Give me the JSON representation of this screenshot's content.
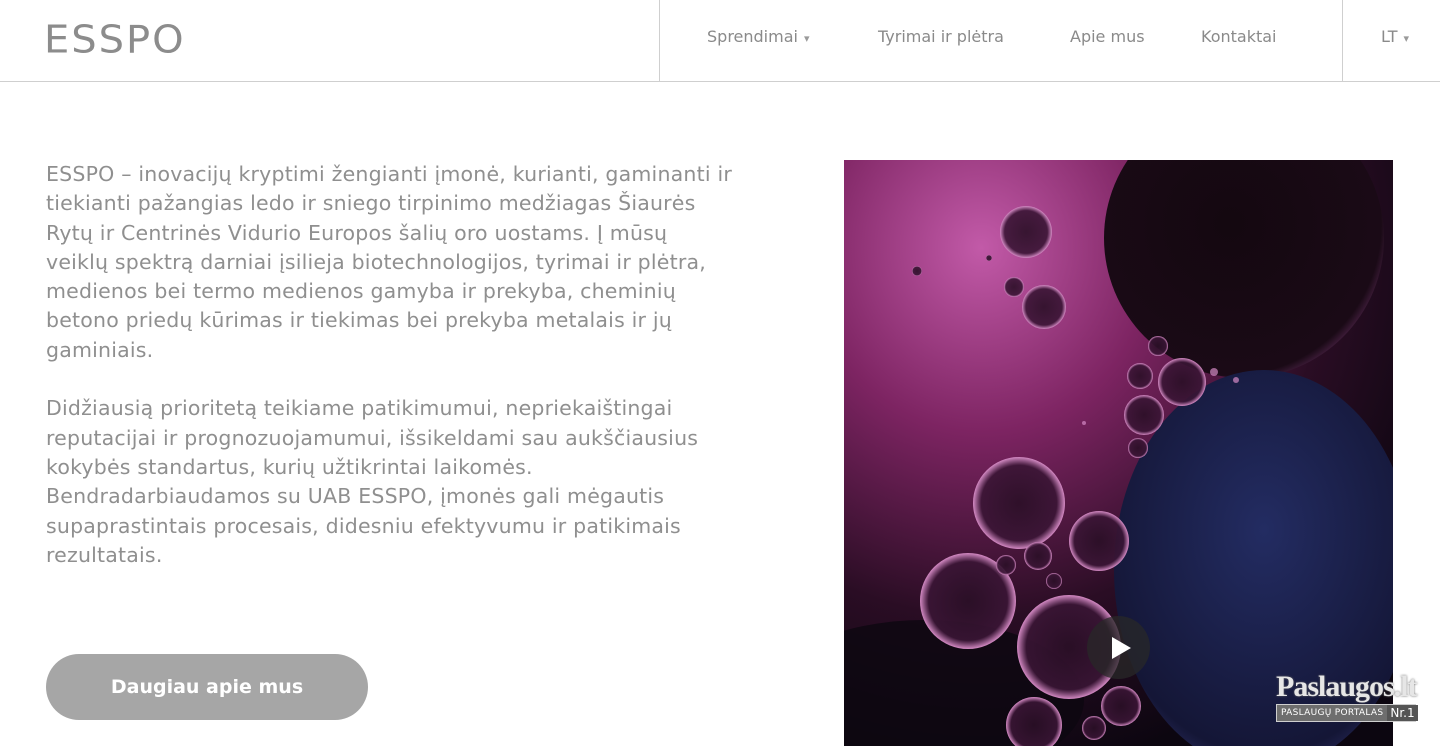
{
  "header": {
    "logo": "ESSPO",
    "nav": [
      {
        "label": "Sprendimai",
        "dropdown": true
      },
      {
        "label": "Tyrimai ir plėtra",
        "dropdown": false
      },
      {
        "label": "Apie mus",
        "dropdown": false
      },
      {
        "label": "Kontaktai",
        "dropdown": false
      }
    ],
    "language": "LT"
  },
  "main": {
    "paragraphs": [
      "ESSPO – inovacijų kryptimi žengianti įmonė, kurianti, gaminanti ir tiekianti pažangias ledo ir sniego tirpinimo medžiagas Šiaurės Rytų ir Centrinės Vidurio Europos šalių oro uostams. Į mūsų veiklų spektrą darniai įsilieja biotechnologijos, tyrimai ir plėtra, medienos bei termo medienos gamyba ir prekyba, cheminių betono priedų kūrimas ir tiekimas bei prekyba metalais ir jų gaminiais.",
      "Didžiausią prioritetą teikiame patikimumui, nepriekaištingai reputacijai ir prognozuojamumui, išsikeldami sau aukščiausius kokybės standartus, kurių užtikrintai laikomės. Bendradarbiaudamos su UAB ESSPO, įmonės gali mėgautis supaprastintais procesais, didesniu efektyvumu ir patikimais rezultatais."
    ],
    "cta_label": "Daugiau apie mus"
  },
  "watermark": {
    "title": "Paslaugos.lt",
    "subtitle": "PASLAUGŲ PORTALAS",
    "badge": "Nr.1"
  },
  "colors": {
    "text": "#8f8f8f",
    "button": "#a6a6a6",
    "video_magenta": "#a0377f",
    "video_blue": "#1f2a5c"
  }
}
